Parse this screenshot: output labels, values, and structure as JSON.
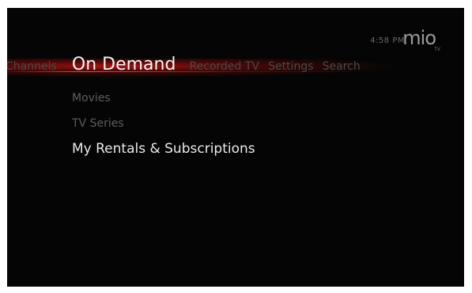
{
  "header": {
    "clock": "4:58 PM",
    "logo": "mio",
    "logo_sub": "TV"
  },
  "tabs": [
    {
      "label": "Channels"
    },
    {
      "label": "On Demand",
      "active": true
    },
    {
      "label": "Recorded TV"
    },
    {
      "label": "Settings"
    },
    {
      "label": "Search"
    }
  ],
  "menu": {
    "items": [
      {
        "label": "Movies"
      },
      {
        "label": "TV Series"
      },
      {
        "label": "My Rentals & Subscriptions",
        "selected": true
      }
    ]
  },
  "colors": {
    "background": "#050505",
    "accent_glow": "#b01414",
    "active_text": "#f4f4f4",
    "inactive_text": "#4a4a4a"
  }
}
